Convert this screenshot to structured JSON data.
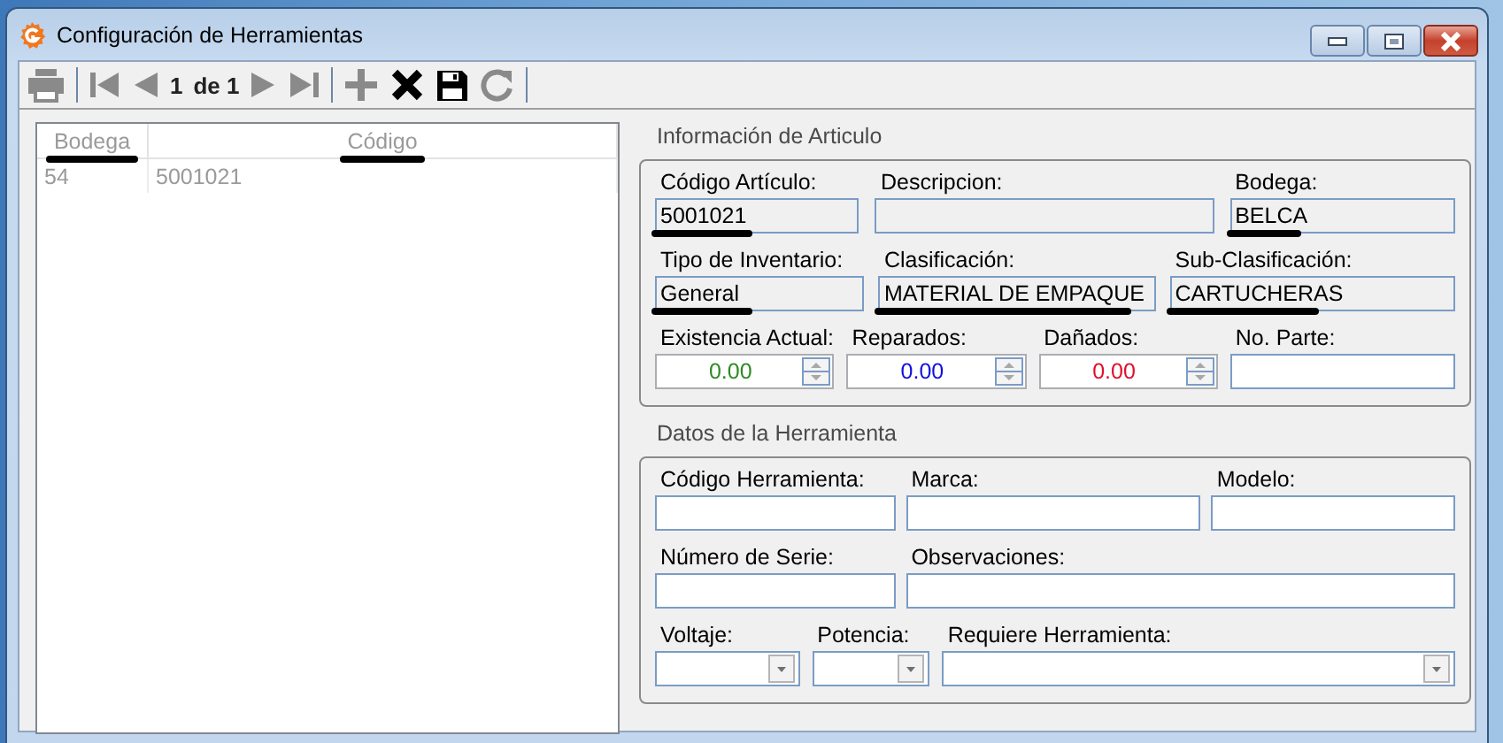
{
  "window": {
    "title": "Configuración de Herramientas"
  },
  "toolbar": {
    "items": [
      {
        "kind": "print",
        "disabled": true
      },
      {
        "kind": "separator"
      },
      {
        "kind": "first",
        "disabled": true
      },
      {
        "kind": "prev",
        "disabled": true
      },
      {
        "kind": "page",
        "text": "1"
      },
      {
        "kind": "of",
        "text": "de 1"
      },
      {
        "kind": "next",
        "disabled": true
      },
      {
        "kind": "last",
        "disabled": true
      },
      {
        "kind": "separator"
      },
      {
        "kind": "add",
        "disabled": true
      },
      {
        "kind": "delete",
        "disabled": false
      },
      {
        "kind": "save",
        "disabled": false
      },
      {
        "kind": "refresh",
        "disabled": true
      },
      {
        "kind": "separator"
      }
    ]
  },
  "grid": {
    "columns": [
      {
        "label": "Bodega",
        "marked": true
      },
      {
        "label": "Código",
        "marked": true
      }
    ],
    "rows": [
      [
        "54",
        "5001021"
      ]
    ]
  },
  "sections": [
    {
      "title": "Información de Articulo",
      "rows": [
        [
          {
            "label": "Código Artículo:",
            "kind": "text",
            "value": "5001021",
            "marked": true
          },
          {
            "label": "Descripcion:",
            "kind": "text"
          },
          {
            "label": "Bodega:",
            "kind": "text",
            "value": "BELCA",
            "marked": true
          }
        ],
        [
          {
            "label": "Tipo de Inventario:",
            "kind": "text",
            "value": "General",
            "marked": true
          },
          {
            "label": "Clasificación:",
            "kind": "text",
            "value": "MATERIAL DE EMPAQUE",
            "marked": true
          },
          {
            "label": "Sub-Clasificación:",
            "kind": "text",
            "value": "CARTUCHERAS",
            "marked": true
          }
        ],
        [
          {
            "label": "Existencia Actual:",
            "kind": "spin",
            "value": "0.00",
            "color": "#2e8b22"
          },
          {
            "label": "Reparados:",
            "kind": "spin",
            "value": "0.00",
            "color": "#1010e0"
          },
          {
            "label": "Dañados:",
            "kind": "spin",
            "value": "0.00",
            "color": "#e0102a"
          },
          {
            "label": "No. Parte:",
            "kind": "text"
          }
        ]
      ]
    },
    {
      "title": "Datos de la Herramienta",
      "rows": [
        [
          {
            "label": "Código Herramienta:",
            "kind": "text"
          },
          {
            "label": "Marca:",
            "kind": "text"
          },
          {
            "label": "Modelo:",
            "kind": "text"
          }
        ],
        [
          {
            "label": "Número de Serie:",
            "kind": "text"
          },
          {
            "label": "Observaciones:",
            "kind": "text"
          }
        ],
        [
          {
            "label": "Voltaje:",
            "kind": "combo"
          },
          {
            "label": "Potencia:",
            "kind": "combo"
          },
          {
            "label": "Requiere Herramienta:",
            "kind": "combo"
          }
        ]
      ]
    }
  ]
}
